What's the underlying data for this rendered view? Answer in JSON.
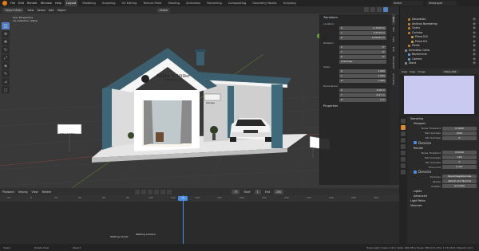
{
  "menu": {
    "items": [
      "File",
      "Edit",
      "Render",
      "Window",
      "Help"
    ],
    "workspaces": [
      "Layout",
      "Modeling",
      "Sculpting",
      "UV Editing",
      "Texture Paint",
      "Shading",
      "Animation",
      "Rendering",
      "Compositing",
      "Geometry Nodes",
      "Scripting"
    ],
    "active_workspace": "Layout",
    "scene": "Scene",
    "view_layer": "ViewLayer"
  },
  "viewport": {
    "mode": "Object Mode",
    "menus": [
      "View",
      "Select",
      "Add",
      "Object"
    ],
    "transform": "Global",
    "info_lines": [
      "User Perspective",
      "(1) Collection | Plane"
    ],
    "booth": {
      "brand_line1": "Miller & Miller",
      "brand_line2": "ARCHITECTS, LTD.",
      "small_sign": "Garage",
      "standing_sign": "Miller & Miller"
    }
  },
  "npanel": {
    "transform_title": "Transform",
    "location_label": "Location:",
    "location": [
      [
        "X",
        "-1.7418 m"
      ],
      [
        "Y",
        "1.0779 m"
      ],
      [
        "Z",
        "0.91422 m"
      ]
    ],
    "rotation_label": "Rotation:",
    "rotation": [
      [
        "X",
        "0°"
      ],
      [
        "Y",
        "0°"
      ],
      [
        "Z",
        "0°"
      ]
    ],
    "mode_label": "XYZ Euler",
    "scale_label": "Scale:",
    "scale": [
      [
        "X",
        "1.000"
      ],
      [
        "Y",
        "1.000"
      ],
      [
        "Z",
        "1.000"
      ]
    ],
    "dimensions_label": "Dimensions:",
    "dimensions": [
      [
        "X",
        "4.58 m"
      ],
      [
        "Y",
        "6.47 m"
      ],
      [
        "Z",
        "0 m"
      ]
    ],
    "properties_title": "Properties",
    "tabs": [
      "Item",
      "Tool",
      "View",
      "Edit",
      "BlenderKit",
      "Animation"
    ]
  },
  "timeline": {
    "menus": [
      "Playback",
      "Keying",
      "View",
      "Marker"
    ],
    "current_frame": "73",
    "start_label": "Start",
    "start": "1",
    "end_label": "End",
    "end": "250",
    "ticks": [
      "-20",
      "0",
      "20",
      "40",
      "60",
      "80",
      "100",
      "120",
      "140",
      "160",
      "180",
      "200",
      "220",
      "240",
      "260",
      "280",
      "300"
    ],
    "markers": [
      "Walking Camer",
      "Walking Camera"
    ]
  },
  "statusbar": {
    "items": [
      "Select",
      "Rotate View",
      "Object"
    ],
    "stats": "Tulsa Light | Cube: 1/1k | Verts: 900,784 | Faces: 830,213 | Tris: 1,711,813 | Objects 1/21"
  },
  "outliner": {
    "rows": [
      "Decoration",
      "Archival Numbering",
      "Chairs",
      "Curtains",
      "Plane.010",
      "Plane.011",
      "Plants",
      "Animation Cams",
      "BezierCircle",
      "Camera",
      "Stand"
    ]
  },
  "image_editor": {
    "menus": [
      "View",
      "View",
      "Image"
    ],
    "image_name": "Plane.001"
  },
  "properties": {
    "sampling": "Sampling",
    "viewport": "Viewport",
    "noise_threshold_label": "Noise Threshold",
    "noise_threshold": "0.1000",
    "max_samples_label": "Max Samples",
    "max_samples": "1024",
    "min_samples_label": "Min Samples",
    "min_samples": "0",
    "denoise_label": "Denoise",
    "render": "Render",
    "r_noise_threshold": "0.0100",
    "r_max_samples": "128",
    "r_min_samples": "0",
    "time_limit_label": "Time Limit",
    "time_limit": "0 sec",
    "denoiser_label": "Denoiser",
    "denoiser": "OpenImageDenoise",
    "passes_label": "Passes",
    "passes": "Albedo and Normal",
    "prefilter_label": "Prefilter",
    "prefilter": "Accurate",
    "lights": "Lights",
    "advanced": "Advanced",
    "light_paths": "Light Paths",
    "volumes": "Volumes"
  }
}
